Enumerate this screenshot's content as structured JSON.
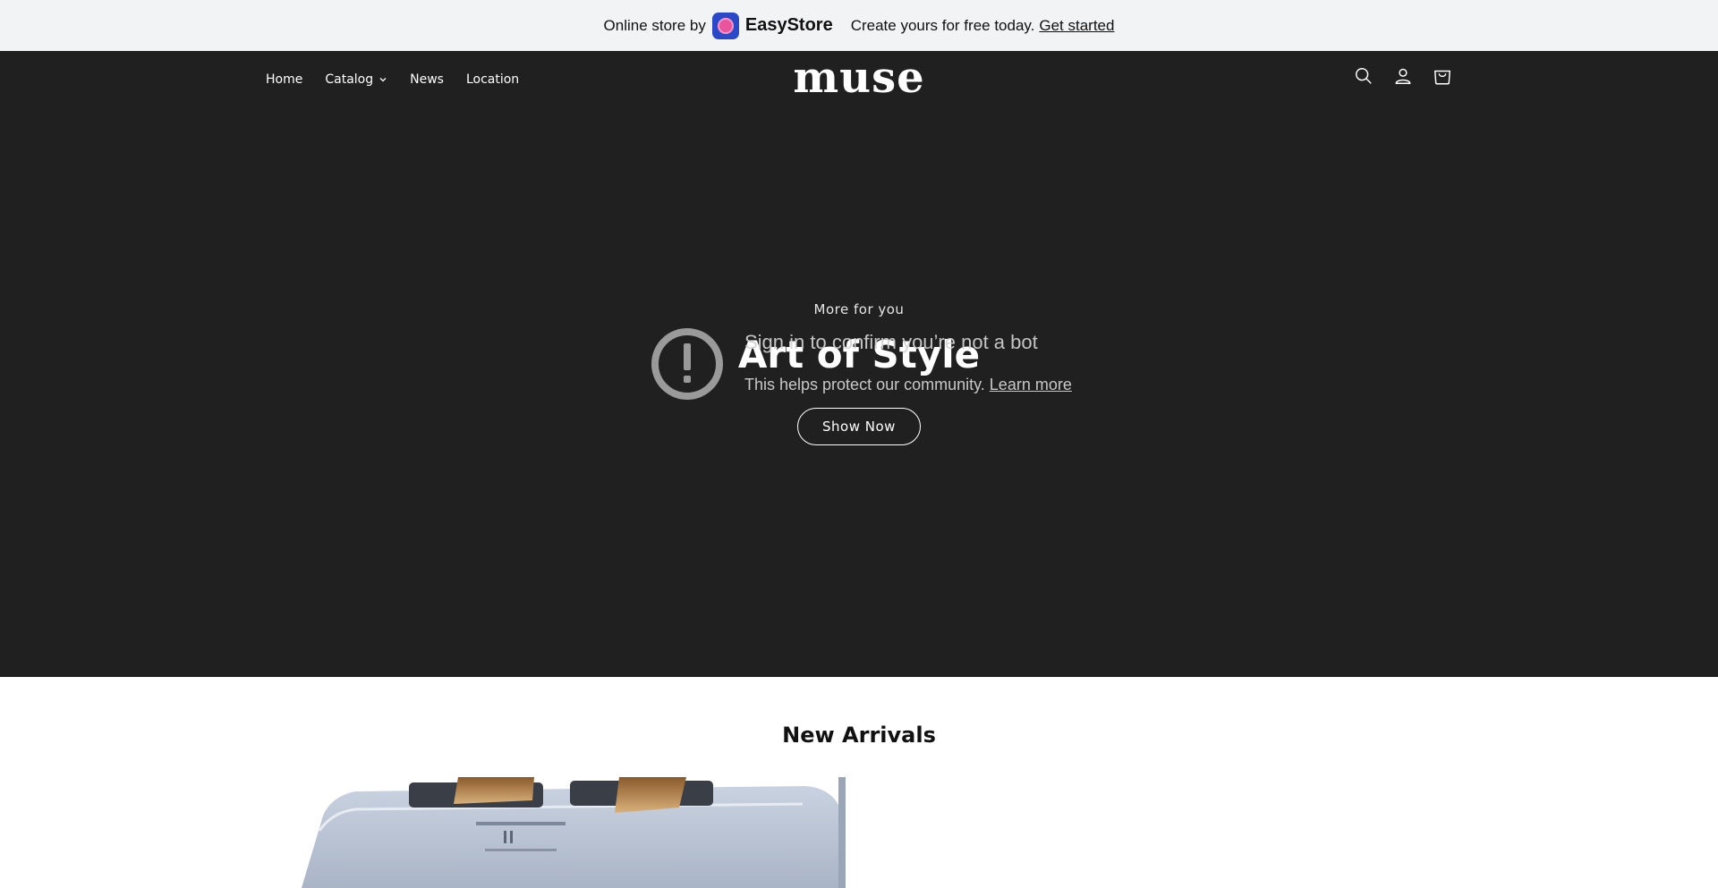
{
  "topbar": {
    "prefix": "Online store by",
    "brand": "EasyStore",
    "promo": "Create yours for free today.",
    "cta": "Get started"
  },
  "header": {
    "logo": "muse",
    "nav": [
      {
        "label": "Home"
      },
      {
        "label": "Catalog"
      },
      {
        "label": "News"
      },
      {
        "label": "Location"
      }
    ],
    "icons": [
      "search-icon",
      "account-icon",
      "cart-icon"
    ]
  },
  "hero": {
    "subtitle": "More for you",
    "title": "Art of Style",
    "button": "Show Now"
  },
  "overlay": {
    "title": "Sign in to confirm you’re not a bot",
    "text": "This helps protect our community.",
    "link": "Learn more"
  },
  "arrivals": {
    "title": "New Arrivals"
  },
  "colors": {
    "header_bg": "#202020",
    "topbar_bg": "#f2f3f5",
    "brand_blue": "#2a49c8"
  }
}
